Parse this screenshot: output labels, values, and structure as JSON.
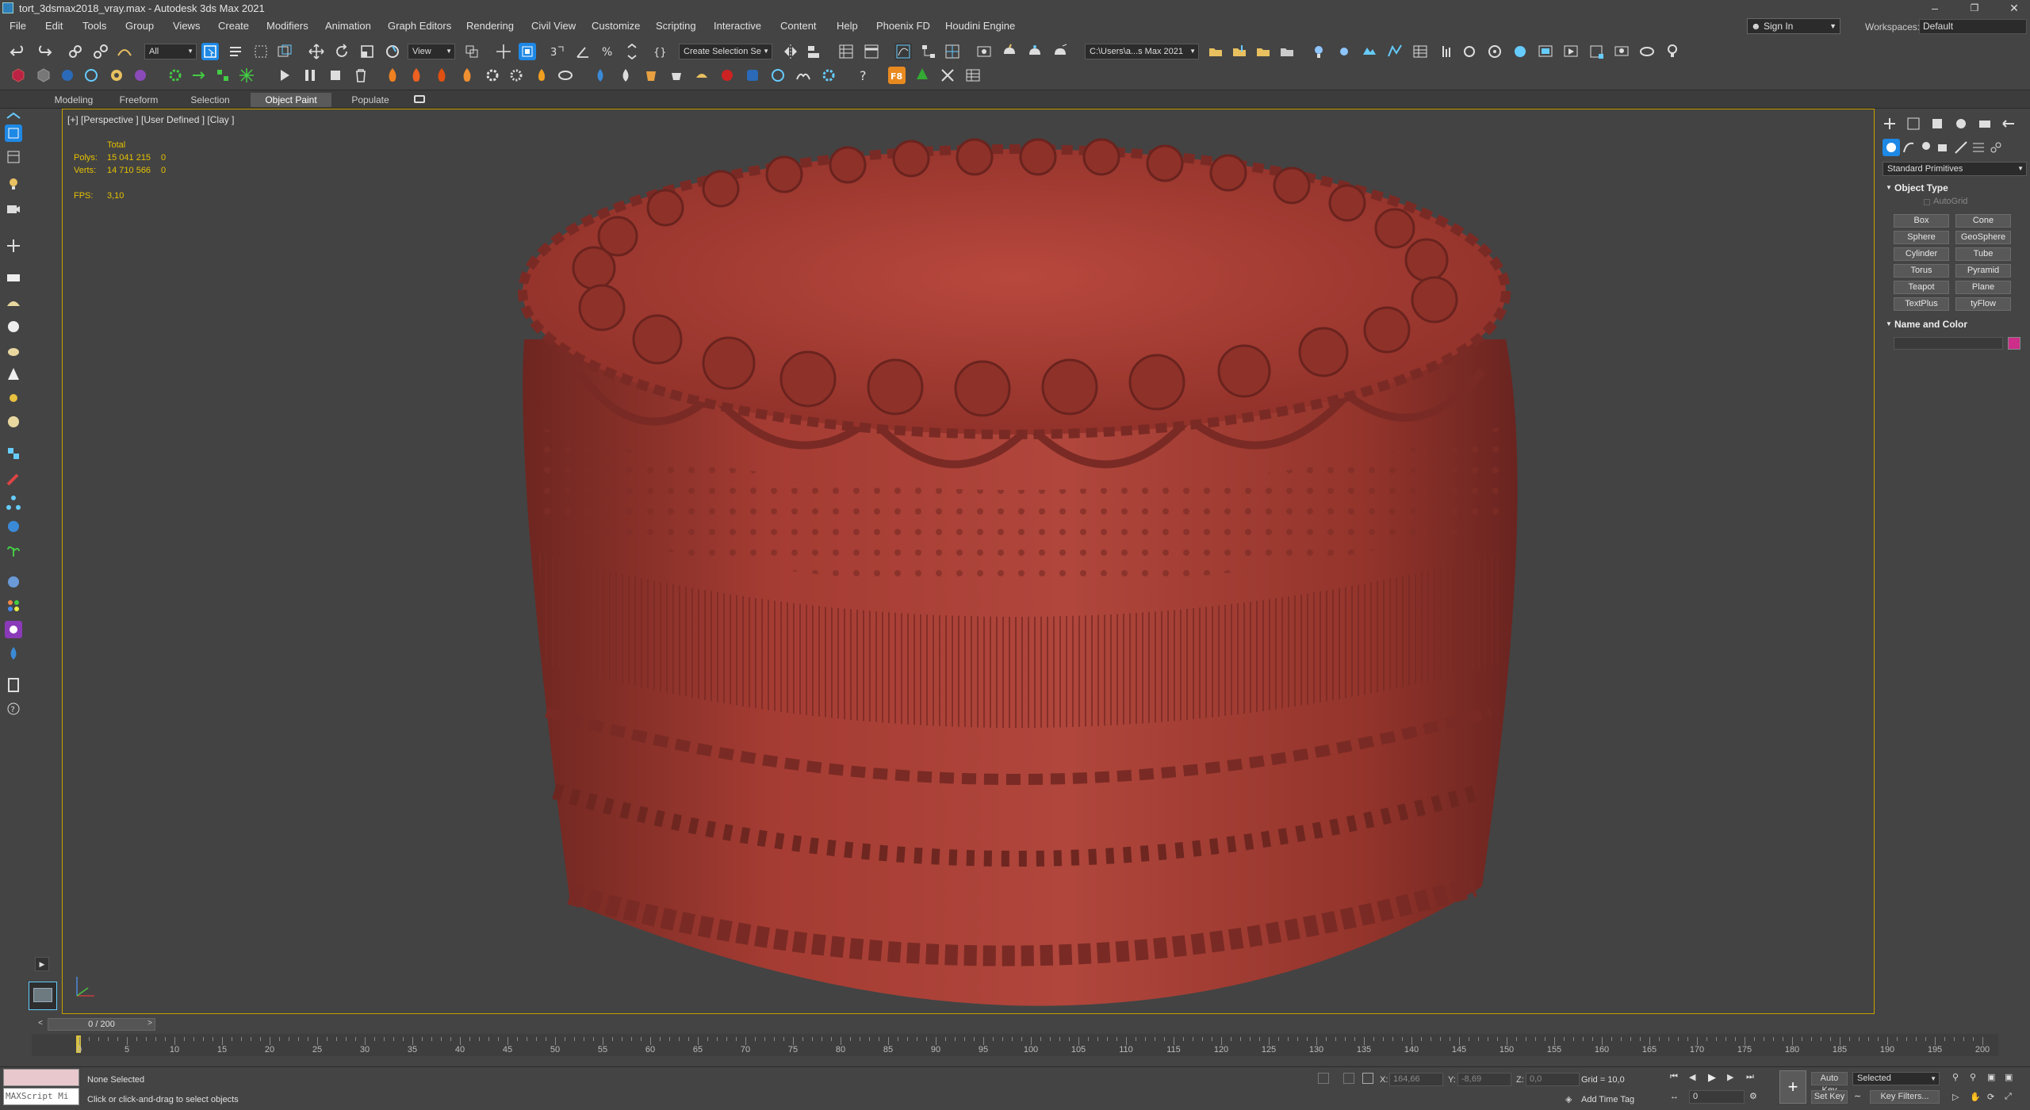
{
  "window": {
    "title": "tort_3dsmax2018_vray.max - Autodesk 3ds Max 2021"
  },
  "menu": [
    "File",
    "Edit",
    "Tools",
    "Group",
    "Views",
    "Create",
    "Modifiers",
    "Animation",
    "Graph Editors",
    "Rendering",
    "Civil View",
    "Customize",
    "Scripting",
    "Interactive",
    "Content",
    "Help",
    "Phoenix FD",
    "Houdini Engine"
  ],
  "account": {
    "signin_label": "Sign In",
    "workspaces_label": "Workspaces:",
    "workspace_value": "Default"
  },
  "toolbar": {
    "filter_value": "All",
    "refcoord_value": "View",
    "selection_set_value": "Create Selection Se",
    "project_path": "C:\\Users\\a...s Max 2021"
  },
  "ribbon_tabs": [
    "Modeling",
    "Freeform",
    "Selection",
    "Object Paint",
    "Populate"
  ],
  "ribbon_active": "Object Paint",
  "viewport": {
    "label": "[+] [Perspective ] [User Defined ] [Clay ]",
    "stats": {
      "total_label": "Total",
      "polys_label": "Polys:",
      "polys_value": "15 041 215",
      "polys_sel": "0",
      "verts_label": "Verts:",
      "verts_value": "14 710 566",
      "verts_sel": "0",
      "fps_label": "FPS:",
      "fps_value": "3,10"
    }
  },
  "command_panel": {
    "category": "Standard Primitives",
    "object_type_title": "Object Type",
    "autogrid_label": "AutoGrid",
    "buttons": [
      "Box",
      "Cone",
      "Sphere",
      "GeoSphere",
      "Cylinder",
      "Tube",
      "Torus",
      "Pyramid",
      "Teapot",
      "Plane",
      "TextPlus",
      "tyFlow"
    ],
    "name_color_title": "Name and Color",
    "object_color": "#cc2e8a"
  },
  "timeline": {
    "frame_display": "0 / 200",
    "ticks": [
      "0",
      "5",
      "10",
      "15",
      "20",
      "25",
      "30",
      "35",
      "40",
      "45",
      "50",
      "55",
      "60",
      "65",
      "70",
      "75",
      "80",
      "85",
      "90",
      "95",
      "100",
      "105",
      "110",
      "115",
      "120",
      "125",
      "130",
      "135",
      "140",
      "145",
      "150",
      "155",
      "160",
      "165",
      "170",
      "175",
      "180",
      "185",
      "190",
      "195",
      "200"
    ]
  },
  "status": {
    "maxscript_label": "MAXScript Mi",
    "selection_status": "None Selected",
    "prompt": "Click or click-and-drag to select objects",
    "x_label": "X:",
    "x_value": "164,66",
    "y_label": "Y:",
    "y_value": "-8,69",
    "z_label": "Z:",
    "z_value": "0,0",
    "grid": "Grid = 10,0",
    "add_time_tag": "Add Time Tag",
    "auto_key": "Auto Key",
    "set_key": "Set Key",
    "selected_value": "Selected",
    "key_filters": "Key Filters...",
    "frame_value": "0"
  },
  "colors": {
    "accent": "#1e88e5",
    "viewport_border": "#c8a000",
    "stats_text": "#e6c100",
    "cake": "#9e3b32"
  }
}
